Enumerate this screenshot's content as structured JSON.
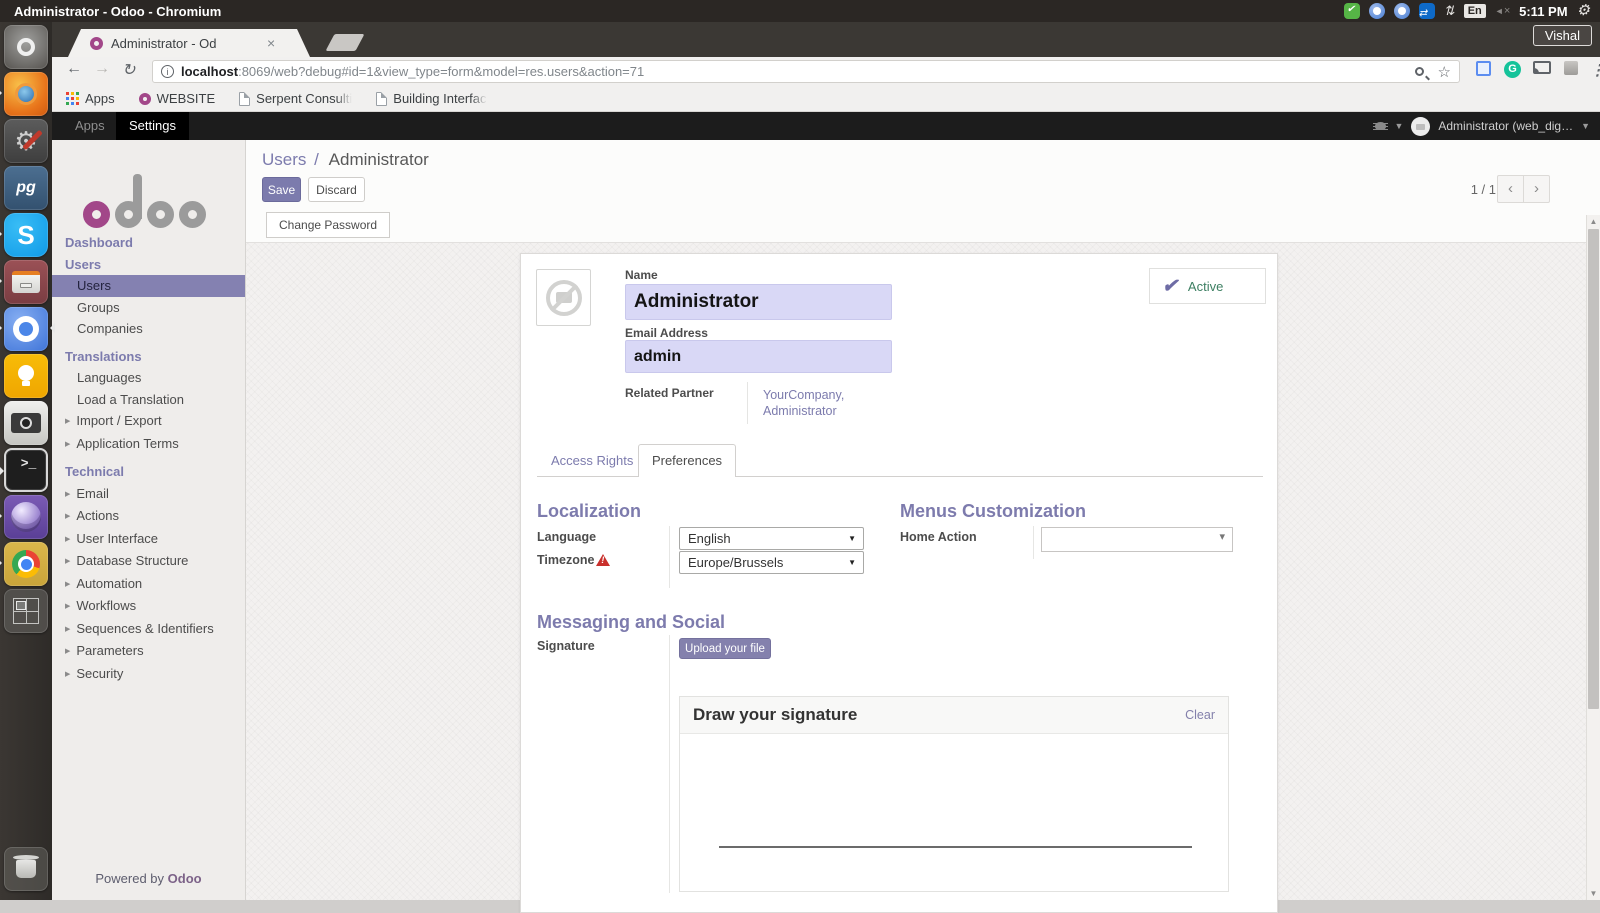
{
  "system": {
    "window_title": "Administrator - Odoo - Chromium",
    "keyboard_layout": "En",
    "time": "5:11 PM"
  },
  "browser": {
    "profile": "Vishal",
    "tab_title": "Administrator - Od",
    "tab_close": "×",
    "url_host": "localhost",
    "url_rest": ":8069/web?debug#id=1&view_type=form&model=res.users&action=71",
    "bookmarks": [
      {
        "label": "Apps",
        "icon": "apps-grid-icon",
        "truncated": false
      },
      {
        "label": "WEBSITE",
        "icon": "odoo-ring-icon",
        "truncated": false
      },
      {
        "label": "Serpent Consulti",
        "icon": "page-icon",
        "truncated": true
      },
      {
        "label": "Building Interfac",
        "icon": "page-icon",
        "truncated": true
      }
    ]
  },
  "launcher": {
    "icons": [
      {
        "name": "ubuntu-dash",
        "running": false,
        "focused": false
      },
      {
        "name": "firefox",
        "running": true,
        "focused": false
      },
      {
        "name": "system-settings",
        "running": false,
        "focused": false
      },
      {
        "name": "postgresql",
        "running": false,
        "focused": false
      },
      {
        "name": "skype",
        "running": true,
        "focused": false
      },
      {
        "name": "archive-manager",
        "running": true,
        "focused": false
      },
      {
        "name": "chromium",
        "running": true,
        "focused": true
      },
      {
        "name": "google-keep",
        "running": false,
        "focused": false
      },
      {
        "name": "camera",
        "running": false,
        "focused": false
      },
      {
        "name": "terminal",
        "running": true,
        "focused": false
      },
      {
        "name": "eclipse",
        "running": true,
        "focused": false
      },
      {
        "name": "chrome",
        "running": true,
        "focused": false
      },
      {
        "name": "workspace-switcher",
        "running": false,
        "focused": false
      }
    ]
  },
  "odoo_nav": {
    "apps": "Apps",
    "settings": "Settings",
    "user": "Administrator (web_dig…"
  },
  "sidebar": {
    "entries": [
      {
        "type": "link",
        "label": "Dashboard"
      },
      {
        "type": "heading",
        "label": "Users"
      },
      {
        "type": "item",
        "label": "Users",
        "selected": true
      },
      {
        "type": "item",
        "label": "Groups"
      },
      {
        "type": "item",
        "label": "Companies"
      },
      {
        "type": "heading",
        "label": "Translations"
      },
      {
        "type": "item",
        "label": "Languages"
      },
      {
        "type": "item",
        "label": "Load a Translation"
      },
      {
        "type": "caret",
        "label": "Import / Export"
      },
      {
        "type": "caret",
        "label": "Application Terms"
      },
      {
        "type": "heading",
        "label": "Technical"
      },
      {
        "type": "caret",
        "label": "Email"
      },
      {
        "type": "caret",
        "label": "Actions"
      },
      {
        "type": "caret",
        "label": "User Interface"
      },
      {
        "type": "caret",
        "label": "Database Structure"
      },
      {
        "type": "caret",
        "label": "Automation"
      },
      {
        "type": "caret",
        "label": "Workflows"
      },
      {
        "type": "caret",
        "label": "Sequences & Identifiers"
      },
      {
        "type": "caret",
        "label": "Parameters"
      },
      {
        "type": "caret",
        "label": "Security"
      }
    ],
    "powered_prefix": "Powered by ",
    "powered_brand": "Odoo"
  },
  "control_panel": {
    "breadcrumb_parent": "Users",
    "breadcrumb_sep": "/",
    "breadcrumb_current": "Administrator",
    "save": "Save",
    "discard": "Discard",
    "pager": "1 / 1",
    "change_password": "Change Password"
  },
  "form": {
    "name_label": "Name",
    "name_value": "Administrator",
    "email_label": "Email Address",
    "email_value": "admin",
    "partner_label": "Related Partner",
    "partner_value_line1": "YourCompany,",
    "partner_value_line2": "Administrator",
    "active_label": "Active",
    "tabs": {
      "0": {
        "label": "Access Rights"
      },
      "1": {
        "label": "Preferences"
      }
    },
    "localization": {
      "title": "Localization",
      "language_label": "Language",
      "language_value": "English",
      "timezone_label": "Timezone",
      "timezone_value": "Europe/Brussels"
    },
    "menus": {
      "title": "Menus Customization",
      "home_action_label": "Home Action",
      "home_action_value": ""
    },
    "messaging": {
      "title": "Messaging and Social",
      "signature_label": "Signature",
      "upload_button": "Upload your file",
      "draw_title": "Draw your signature",
      "clear": "Clear"
    }
  },
  "colors": {
    "odoo_purple": "#7c7bad",
    "input_bg": "#d9d8f6",
    "active_green": "#3d7f62",
    "selected_item_bg": "#8481b1",
    "nav_black": "#1c1c1c"
  }
}
